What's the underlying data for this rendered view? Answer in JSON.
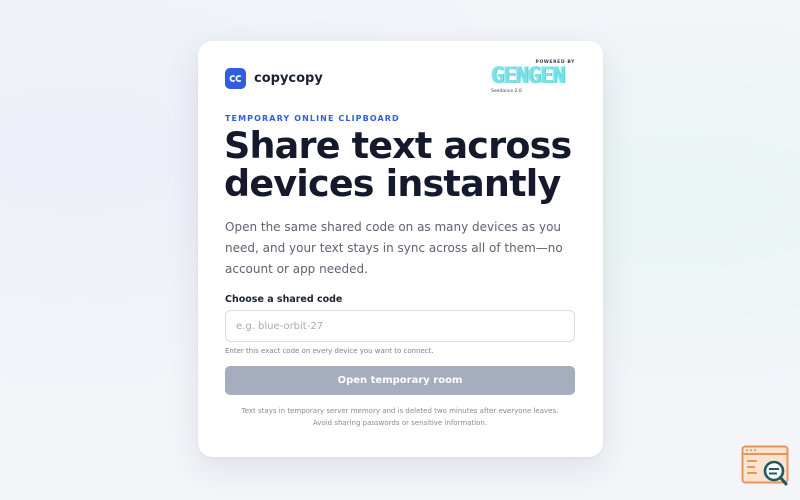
{
  "brand": {
    "name": "copycopy",
    "logo_glyph": "cc",
    "accent_color": "#2f5fe0"
  },
  "powered_by": {
    "label": "POWERED BY",
    "mark": "GENGEN",
    "sub": "Seedance 2.0"
  },
  "hero": {
    "eyebrow": "TEMPORARY ONLINE CLIPBOARD",
    "headline": "Share text across devices instantly",
    "description": "Open the same shared code on as many devices as you need, and your text stays in sync across all of them—no account or app needed."
  },
  "form": {
    "code_label": "Choose a shared code",
    "code_value": "",
    "code_placeholder": "e.g. blue-orbit-27",
    "hint": "Enter this exact code on every device you want to connect.",
    "submit_label": "Open temporary room",
    "submit_disabled": true
  },
  "footer_note": {
    "line1": "Text stays in temporary server memory and is deleted two minutes after everyone leaves.",
    "line2": "Avoid sharing passwords or sensitive information."
  },
  "corner_badge": {
    "icon": "browser-search-icon"
  }
}
